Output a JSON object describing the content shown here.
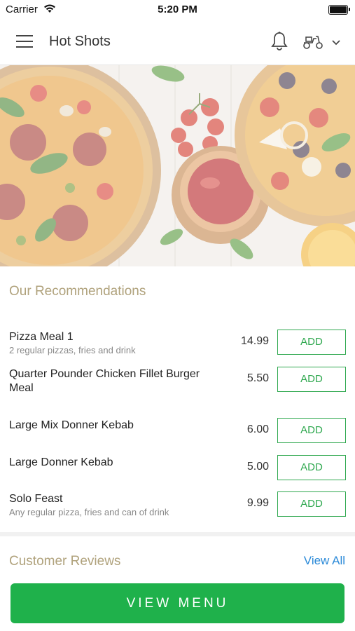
{
  "status_bar": {
    "carrier": "Carrier",
    "time": "5:20 PM"
  },
  "header": {
    "title": "Hot Shots",
    "icons": {
      "menu": "hamburger-menu-icon",
      "notifications": "bell-icon",
      "delivery": "scooter-icon",
      "dropdown": "chevron-down-icon"
    }
  },
  "recommendations": {
    "title": "Our Recommendations",
    "items": [
      {
        "name": "Pizza Meal 1",
        "description": "2 regular pizzas, fries and drink",
        "price": "14.99",
        "button": "ADD"
      },
      {
        "name": "Quarter Pounder Chicken Fillet Burger Meal",
        "description": "",
        "price": "5.50",
        "button": "ADD"
      },
      {
        "name": "Large Mix Donner Kebab",
        "description": "",
        "price": "6.00",
        "button": "ADD"
      },
      {
        "name": "Large Donner Kebab",
        "description": "",
        "price": "5.00",
        "button": "ADD"
      },
      {
        "name": "Solo Feast",
        "description": "Any regular pizza, fries and can of drink",
        "price": "9.99",
        "button": "ADD"
      }
    ]
  },
  "reviews": {
    "title": "Customer Reviews",
    "view_all": "View All"
  },
  "cta": {
    "label": "VIEW MENU"
  },
  "colors": {
    "accent_green": "#1fb14b",
    "section_title": "#b0a27c",
    "link_blue": "#2b8ad8"
  }
}
